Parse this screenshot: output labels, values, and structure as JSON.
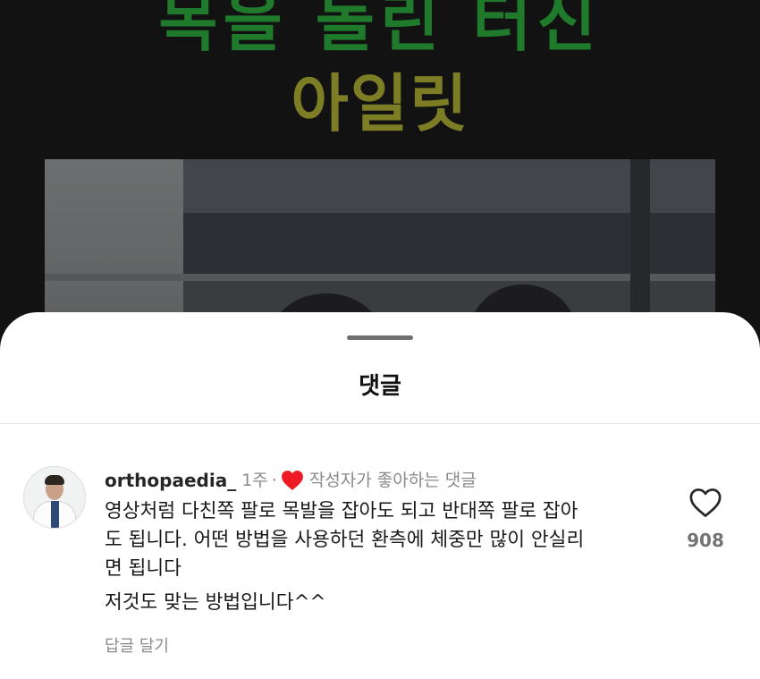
{
  "video": {
    "title_top": "목을 돌린 터신",
    "title_main": "아일릿"
  },
  "sheet": {
    "title": "댓글"
  },
  "comment": {
    "username": "orthopaedia_",
    "time": "1주",
    "separator": "·",
    "creator_liked_label": "작성자가 좋아하는 댓글",
    "lines": [
      "영상처럼 다친쪽 팔로 목발을 잡아도 되고 반대쪽 팔로 잡아",
      "도 됩니다. 어떤 방법을 사용하던 환측에 체중만 많이 안실리",
      "면 됩니다",
      "저것도 맞는 방법입니다^^"
    ],
    "reply_label": "답글 달기",
    "like_count": "908",
    "icons": {
      "creator_heart": "heart-filled-icon",
      "like": "heart-outline-icon"
    },
    "colors": {
      "creator_heart": "#ed1c24"
    }
  }
}
